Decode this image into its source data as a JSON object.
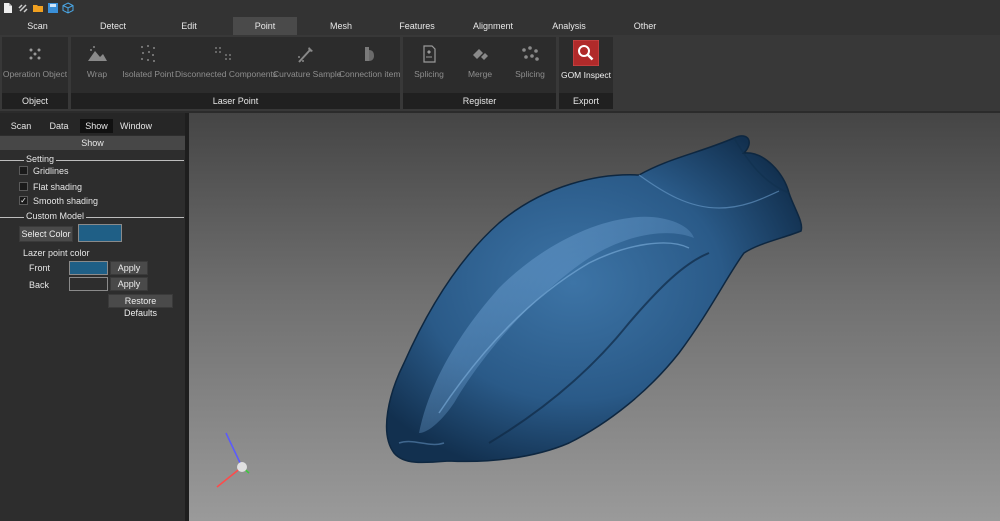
{
  "quick_access": [
    {
      "icon": "new-file-icon"
    },
    {
      "icon": "link-icon"
    },
    {
      "icon": "open-folder-icon"
    },
    {
      "icon": "save-icon"
    },
    {
      "icon": "cube-icon"
    }
  ],
  "menu_tabs": [
    {
      "label": "Scan"
    },
    {
      "label": "Detect"
    },
    {
      "label": "Edit"
    },
    {
      "label": "Point"
    },
    {
      "label": "Mesh"
    },
    {
      "label": "Features"
    },
    {
      "label": "Alignment"
    },
    {
      "label": "Analysis"
    },
    {
      "label": "Other"
    }
  ],
  "active_menu_tab": "Point",
  "ribbon": {
    "groups": [
      {
        "title": "Object",
        "buttons": [
          {
            "label": "Operation Object",
            "icon": "operation-object-icon"
          }
        ]
      },
      {
        "title": "Laser Point",
        "buttons": [
          {
            "label": "Wrap",
            "icon": "wrap-icon"
          },
          {
            "label": "Isolated Point",
            "icon": "isolated-point-icon"
          },
          {
            "label": "Disconnected Components",
            "icon": "disconnected-components-icon"
          },
          {
            "label": "Curvature Sample",
            "icon": "curvature-sample-icon"
          },
          {
            "label": "Connection item",
            "icon": "connection-item-icon"
          }
        ]
      },
      {
        "title": "Register",
        "buttons": [
          {
            "label": "Splicing",
            "icon": "splicing-icon"
          },
          {
            "label": "Merge",
            "icon": "merge-icon"
          },
          {
            "label": "Splicing",
            "icon": "splicing-points-icon"
          }
        ]
      },
      {
        "title": "Export",
        "buttons": [
          {
            "label": "GOM Inspect",
            "icon": "gom-inspect-icon"
          }
        ]
      }
    ]
  },
  "panel": {
    "tabs": [
      {
        "label": "Scan"
      },
      {
        "label": "Data"
      },
      {
        "label": "Show"
      },
      {
        "label": "Window"
      }
    ],
    "active_tab": "Show",
    "header": "Show",
    "setting": {
      "title": "Setting",
      "options": [
        {
          "label": "Gridlines",
          "checked": false
        },
        {
          "label": "Flat shading",
          "checked": false
        },
        {
          "label": "Smooth shading",
          "checked": true
        }
      ]
    },
    "custom_model": {
      "title": "Custom Model",
      "select_color_label": "Select Color",
      "model_color": "#1f5f86"
    },
    "lazer_point": {
      "title": "Lazer point color",
      "front_label": "Front",
      "front_color": "#1f5f86",
      "back_label": "Back",
      "back_color": "#2d2d2d",
      "apply_label": "Apply",
      "restore_label": "Restore Defaults"
    }
  },
  "colors": {
    "accent_export": "#b02a2a",
    "model": "#2d5f8f"
  }
}
